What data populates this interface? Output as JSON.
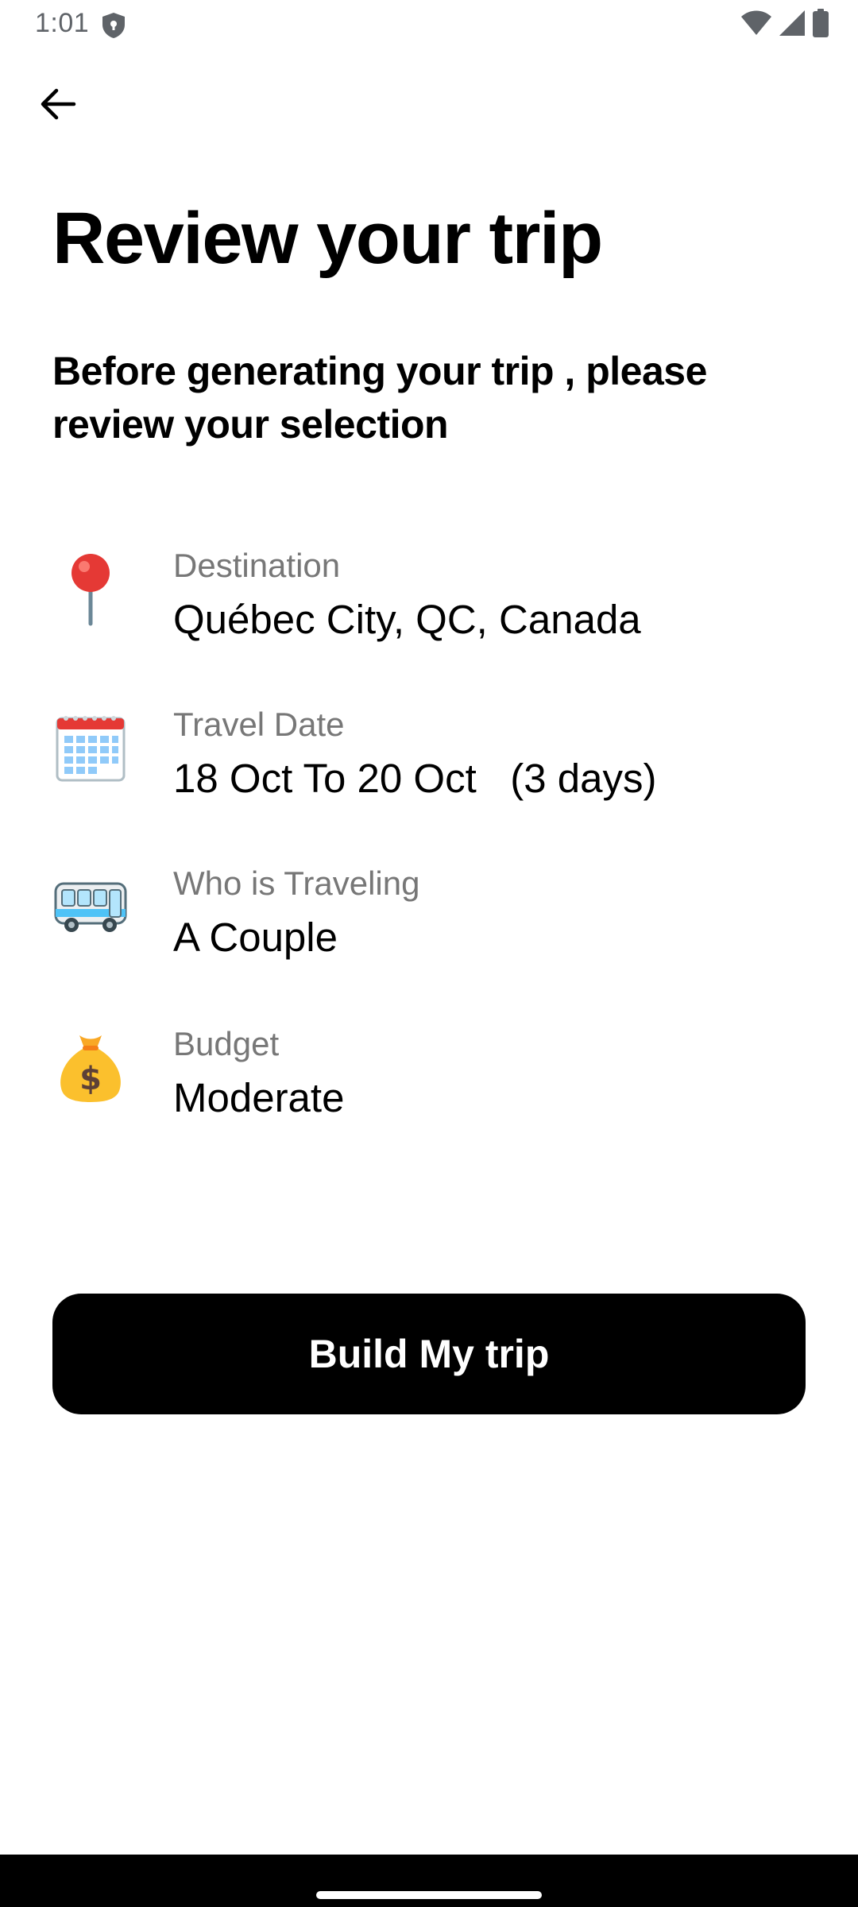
{
  "status_bar": {
    "time": "1:01",
    "icons": [
      "shield-icon",
      "wifi-icon",
      "signal-icon",
      "battery-icon"
    ]
  },
  "header": {
    "back_icon": "arrow-left-icon"
  },
  "title": "Review your trip",
  "subtitle": "Before generating your trip , please review your selection",
  "items": [
    {
      "icon": "pushpin-icon",
      "label": "Destination",
      "value": "Québec City, QC, Canada"
    },
    {
      "icon": "calendar-icon",
      "label": "Travel Date",
      "value": "18 Oct To 20 Oct   (3 days)"
    },
    {
      "icon": "bus-icon",
      "label": "Who is Traveling",
      "value": "A Couple"
    },
    {
      "icon": "money-bag-icon",
      "label": "Budget",
      "value": "Moderate"
    }
  ],
  "build_button": {
    "label": "Build My trip"
  },
  "colors": {
    "background": "#ffffff",
    "text": "#000000",
    "label_gray": "#777777",
    "button_bg": "#000000",
    "button_text": "#ffffff"
  }
}
